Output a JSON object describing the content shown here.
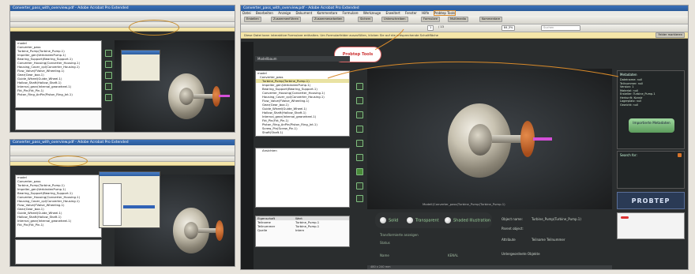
{
  "left_top": {
    "title": "Converter_pass_with_overview.pdf - Adobe Acrobat Pro Extended"
  },
  "left_bottom": {
    "title": "Converter_pass_with_overview.pdf - Adobe Acrobat Pro Extended"
  },
  "main": {
    "title": "Converter_pass_with_overview.pdf - Adobe Acrobat Pro Extended",
    "menu": [
      "Datei",
      "Bearbeiten",
      "Anzeige",
      "Dokument",
      "Kommentare",
      "Formulare",
      "Werkzeuge",
      "Erweitert",
      "Fenster",
      "Hilfe",
      "Probtep Tools"
    ],
    "toolbar": {
      "create": "Erstellen",
      "combine": "Zusammenführen",
      "collaborate": "Zusammenarbeiten",
      "secure": "Sichern",
      "sign": "Unterschreiben",
      "forms": "Formulare",
      "multimedia": "Multimedia",
      "comments": "Kommentare",
      "page": "1",
      "page_total": "/ 13",
      "zoom": "84,3%",
      "search_placeholder": "Suchen"
    },
    "yellow_notice": "Diese Datei kann interaktive Formulare enthalten. Um Formularfelder auszufüllen, klicken Sie auf die entsprechende Schaltfläche",
    "yellow_button": "Felder markieren",
    "callout_label": "Probtep Tools",
    "model_tree_title": "Modellbaum",
    "tree": [
      "model",
      "Converter_pass",
      "Turbine_Pump(Turbine_Pump.1)",
      "Impeller_gen(VerbindenPump.1)",
      "Bearing_Support(Bearing_Support.1)",
      "Converter_Housing(Converter_Housing.1)",
      "Housing_Cover_cpl(Converter_Housing.1)",
      "Flow_Valve(FValve_Wheeling.1)",
      "Gear(Gear_box.1)",
      "Guide_Wheel(Guide_Wheel.1)",
      "Hollow_Shaft(Hollow_Shaft.1)",
      "Internal_gear(Internal_gearwheel.1)",
      "Fkt_Pin(Fkt_Pin.1)",
      "Piston_Ring_AnPin(Piston_Ring_Jnt.1)",
      "Screw_Pin(Screw_Pin.1)",
      "Shaft(Shaft.1)"
    ],
    "tree_secondary": [
      "Ansichten"
    ],
    "props_headers": [
      "Eigenschaft",
      "Wert"
    ],
    "props_rows": [
      [
        "Teilname",
        "Turbine_Pump.1"
      ],
      [
        "Teilnummer",
        "Turbine_Pump.1"
      ],
      [
        "Quelle",
        "Intern"
      ]
    ],
    "canvas_label": "Modell(Converter_pass(Turbine_Pump(Turbine_Pump.1)",
    "render_modes": [
      "Solid",
      "Transparent",
      "Shaded Illustration"
    ],
    "bottom_labels": {
      "transform": "Transformierte anzeigen",
      "status": "Status",
      "name": "Name",
      "name_value": "KENAL",
      "object_name_label": "Object name:",
      "object_name_value": "Turbine_Pump(Turbine_Pump.1)",
      "parent_object": "Parent object:",
      "attribute": "Attribute",
      "attribute_value": "Teilname Teilnummer",
      "child_label": "Untergeordnete Objekte"
    },
    "metadata_title": "Metadaten",
    "metadata": [
      [
        "Dateiname:",
        "null"
      ],
      [
        "Teilnummer:",
        "null"
      ],
      [
        "Version:",
        "1"
      ],
      [
        "Material:",
        "null"
      ],
      [
        "Ersteller:",
        "Turbine_Pump.1"
      ],
      [
        "Herkunft:",
        "Konstr"
      ],
      [
        "Lagerplatz:",
        "null"
      ],
      [
        "Gewicht:",
        "null"
      ]
    ],
    "import_button": "Importierte Metadaten",
    "search_label": "Search for:",
    "logo": "PROBTEP",
    "statusbar": "480 x 240 mm"
  },
  "colors": {
    "accent": "#3a6fb8",
    "panel_dark": "#2a2d2e",
    "highlight_orange": "#d88a2a",
    "green": "#8fcf8f"
  }
}
